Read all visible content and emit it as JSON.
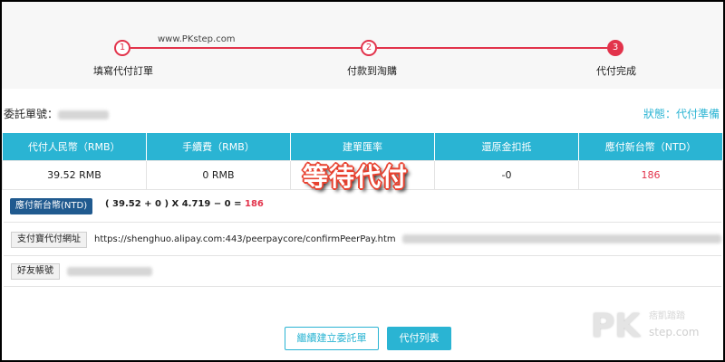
{
  "watermark": "www.PKstep.com",
  "steps": [
    {
      "number": "1",
      "label": "填寫代付訂單"
    },
    {
      "number": "2",
      "label": "付款到淘購"
    },
    {
      "number": "3",
      "label": "代付完成"
    }
  ],
  "order": {
    "label": "委託單號：",
    "status": "狀態：代付準備"
  },
  "table": {
    "headers": [
      "代付人民幣（RMB）",
      "手續費（RMB）",
      "建單匯率",
      "還原金扣抵",
      "應付新台幣（NTD）"
    ],
    "row": [
      "39.52 RMB",
      "0 RMB",
      "",
      "-0",
      "186"
    ]
  },
  "overlay": "等待代付",
  "formula": {
    "badge": "應付新台幣(NTD)",
    "expression": "( 39.52 + 0 )  X 4.719  − 0 = ",
    "result": "186"
  },
  "alipay": {
    "label": "支付寶代付網址",
    "url": "https://shenghuo.alipay.com:443/peerpaycore/confirmPeerPay.htm"
  },
  "friend": {
    "label": "好友帳號"
  },
  "buttons": {
    "continue": "繼續建立委託單",
    "list": "代付列表"
  },
  "logo": {
    "mark": "PK",
    "name": "痞凱踏踏",
    "url": "step.com"
  },
  "colors": {
    "accent": "#2ab4d3",
    "step_red": "#e2334b",
    "badge_navy": "#205a8f"
  }
}
